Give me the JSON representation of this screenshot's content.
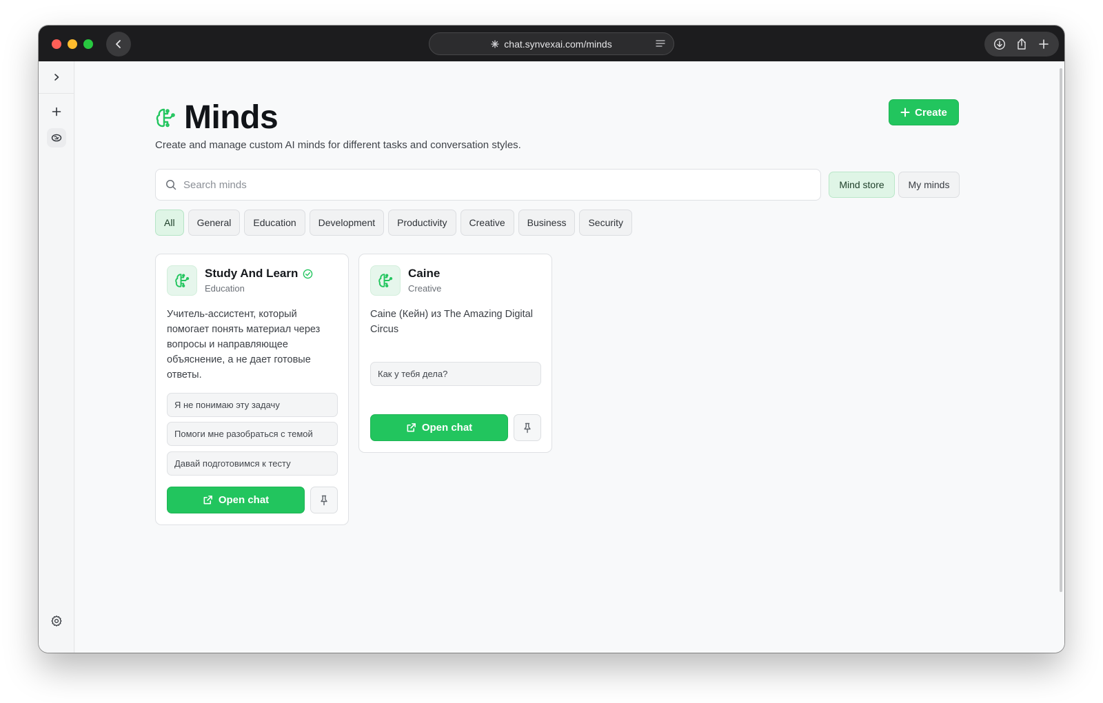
{
  "browser": {
    "url": "chat.synvexai.com/minds"
  },
  "page": {
    "title": "Minds",
    "subtitle": "Create and manage custom AI minds for different tasks and conversation styles.",
    "create_label": "Create",
    "search_placeholder": "Search minds",
    "segments": {
      "store": "Mind store",
      "mine": "My minds"
    },
    "categories": [
      "All",
      "General",
      "Education",
      "Development",
      "Productivity",
      "Creative",
      "Business",
      "Security"
    ],
    "active_category": "All"
  },
  "cards": [
    {
      "name": "Study And Learn",
      "verified": true,
      "category": "Education",
      "description": "Учитель-ассистент, который помогает понять материал через вопросы и направляющее объяснение, а не дает готовые ответы.",
      "prompts": [
        "Я не понимаю эту задачу",
        "Помоги мне разобраться с темой",
        "Давай подготовимся к тесту"
      ],
      "open_label": "Open chat"
    },
    {
      "name": "Caine",
      "verified": false,
      "category": "Creative",
      "description": "Caine (Кейн) из The Amazing Digital Circus",
      "prompts": [
        "Как у тебя дела?"
      ],
      "open_label": "Open chat"
    }
  ],
  "colors": {
    "accent": "#22c55e",
    "accent_soft": "#dff5e6",
    "titlebar": "#1c1c1e"
  },
  "icons": {
    "brand": "brain-icon",
    "verified": "check-circle-icon",
    "open": "external-link-icon",
    "pin": "pin-icon"
  }
}
